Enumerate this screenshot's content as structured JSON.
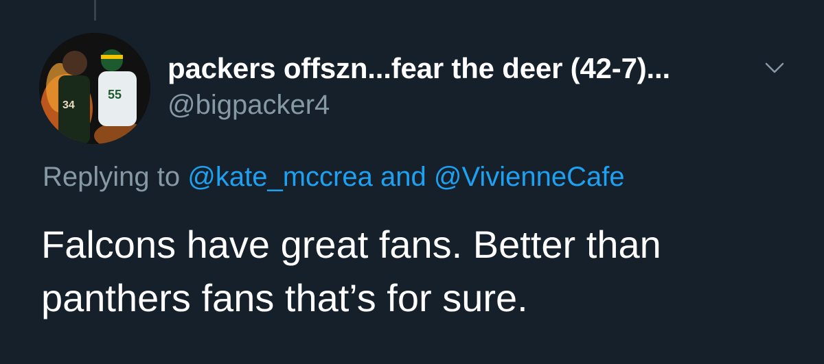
{
  "tweet": {
    "display_name": "packers offszn...fear the deer (42-7)...",
    "handle": "@bigpacker4",
    "avatar_icon": "profile-avatar-icon",
    "more_icon": "chevron-down-icon",
    "replying_prefix": "Replying to",
    "replying_user_1": "@kate_mccrea",
    "replying_joiner": "and",
    "replying_user_2": "@VivienneCafe",
    "text_line_1": "Falcons have great fans. Better than",
    "text_line_2": "panthers fans that’s for sure."
  },
  "colors": {
    "background": "#15202b",
    "primary_text": "#ffffff",
    "secondary_text": "#8899a6",
    "accent": "#1da1f2"
  }
}
